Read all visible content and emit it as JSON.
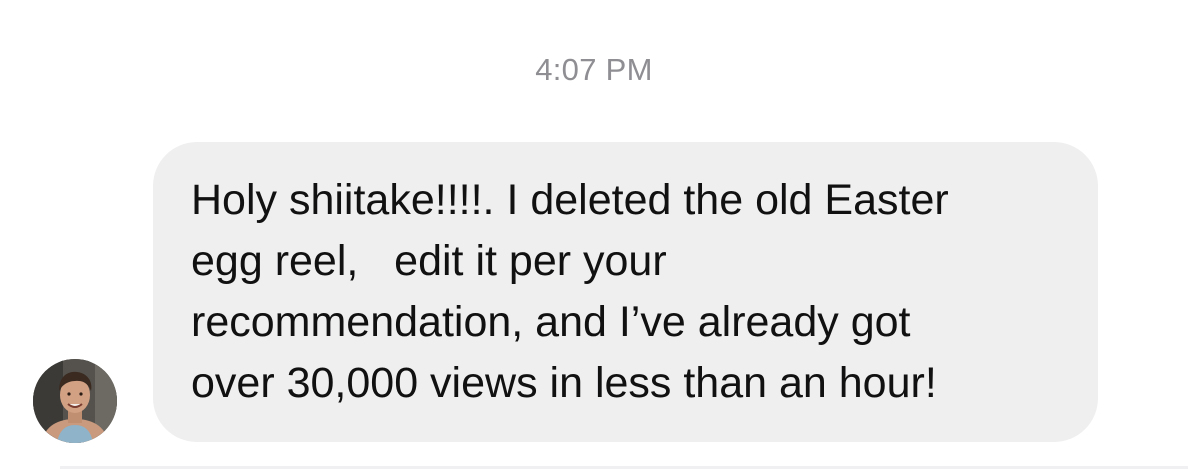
{
  "thread": {
    "timestamp": "4:07 PM"
  },
  "message": {
    "sender_avatar_icon": "user-avatar-photo",
    "text": "Holy shiitake!!!!. I deleted the old Easter\negg reel,   edit it per your\nrecommendation, and I’ve already got\nover 30,000 views in less than an hour!",
    "bubble_color": "#efeff0"
  }
}
